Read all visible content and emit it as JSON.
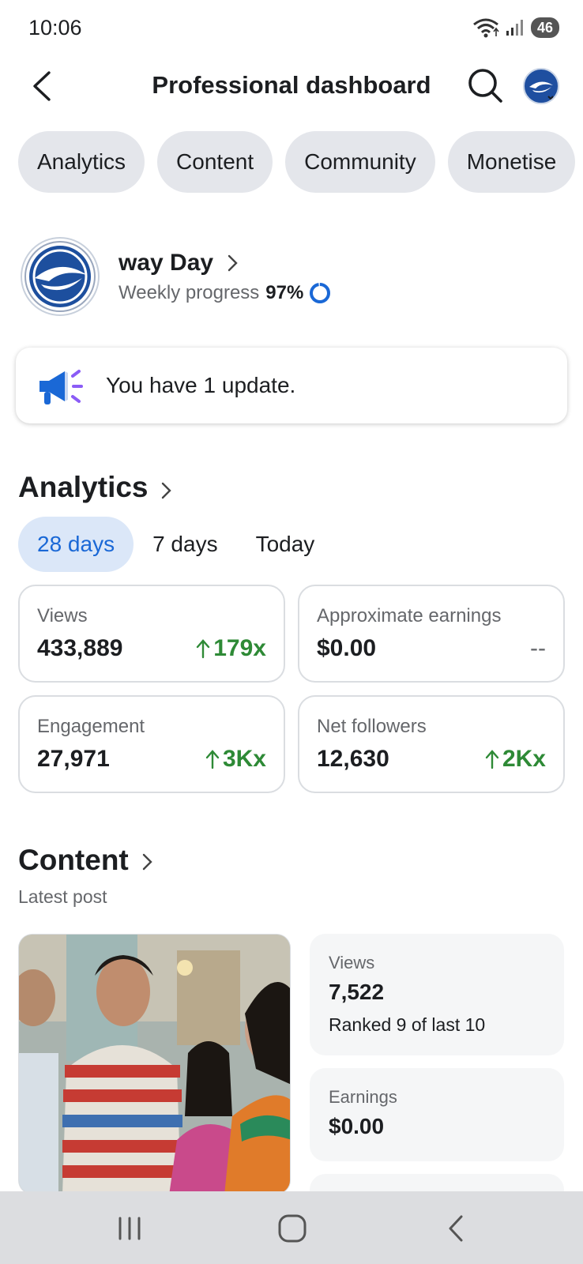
{
  "status": {
    "time": "10:06",
    "battery": "46",
    "wifi_icon": "wifi-icon",
    "signal_icon": "signal-icon"
  },
  "header": {
    "title": "Professional dashboard",
    "back_icon": "back-arrow-icon",
    "search_icon": "search-icon"
  },
  "tabs": [
    {
      "label": "Analytics"
    },
    {
      "label": "Content"
    },
    {
      "label": "Community"
    },
    {
      "label": "Monetise"
    }
  ],
  "profile": {
    "name": "way Day",
    "progress_label": "Weekly progress",
    "progress_value": "97%",
    "progress_fraction": 0.97
  },
  "update": {
    "text": "You have 1 update."
  },
  "analytics": {
    "title": "Analytics",
    "ranges": [
      {
        "label": "28 days",
        "active": true
      },
      {
        "label": "7 days",
        "active": false
      },
      {
        "label": "Today",
        "active": false
      }
    ],
    "metrics": [
      {
        "label": "Views",
        "value": "433,889",
        "change": "179x",
        "trend": "up"
      },
      {
        "label": "Approximate earnings",
        "value": "$0.00",
        "change": "--",
        "trend": "none"
      },
      {
        "label": "Engagement",
        "value": "27,971",
        "change": "3Kx",
        "trend": "up"
      },
      {
        "label": "Net followers",
        "value": "12,630",
        "change": "2Kx",
        "trend": "up"
      }
    ]
  },
  "content": {
    "title": "Content",
    "latest_label": "Latest post",
    "views_label": "Views",
    "views_value": "7,522",
    "views_rank": "Ranked 9 of last 10",
    "earnings_label": "Earnings",
    "earnings_value": "$0.00"
  },
  "colors": {
    "accent": "#1a68d6",
    "positive": "#2e8a36",
    "chip_bg": "#e4e6eb",
    "active_range_bg": "#dbe7f8"
  }
}
